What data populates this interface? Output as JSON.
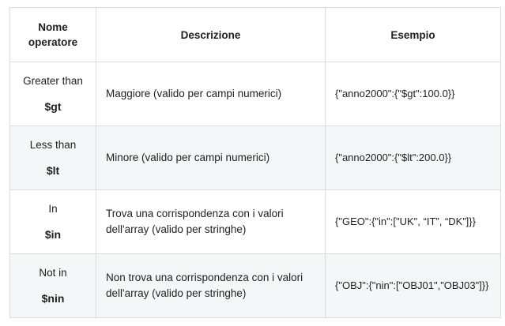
{
  "table": {
    "headers": {
      "operator_line1": "Nome",
      "operator_line2": "operatore",
      "description": "Descrizione",
      "example": "Esempio"
    },
    "rows": [
      {
        "name": "Greater than",
        "code": "$gt",
        "description": "Maggiore (valido per campi numerici)",
        "example": "{\"anno2000\":{\"$gt\":100.0}}"
      },
      {
        "name": "Less than",
        "code": "$lt",
        "description": "Minore (valido per campi numerici)",
        "example": "{\"anno2000\":{\"$lt\":200.0}}"
      },
      {
        "name": "In",
        "code": "$in",
        "description": "Trova una corrispondenza con i valori dell'array (valido per stringhe)",
        "example": "{\"GEO\":{\"in\":[\"UK\", “IT”, “DK”]}}"
      },
      {
        "name": "Not in",
        "code": "$nin",
        "description": "Non trova una corrispondenza con i valori dell'array (valido per stringhe)",
        "example": "{\"OBJ\":{\"nin\":[\"OBJ01\",\"OBJ03\"]}}"
      }
    ]
  }
}
